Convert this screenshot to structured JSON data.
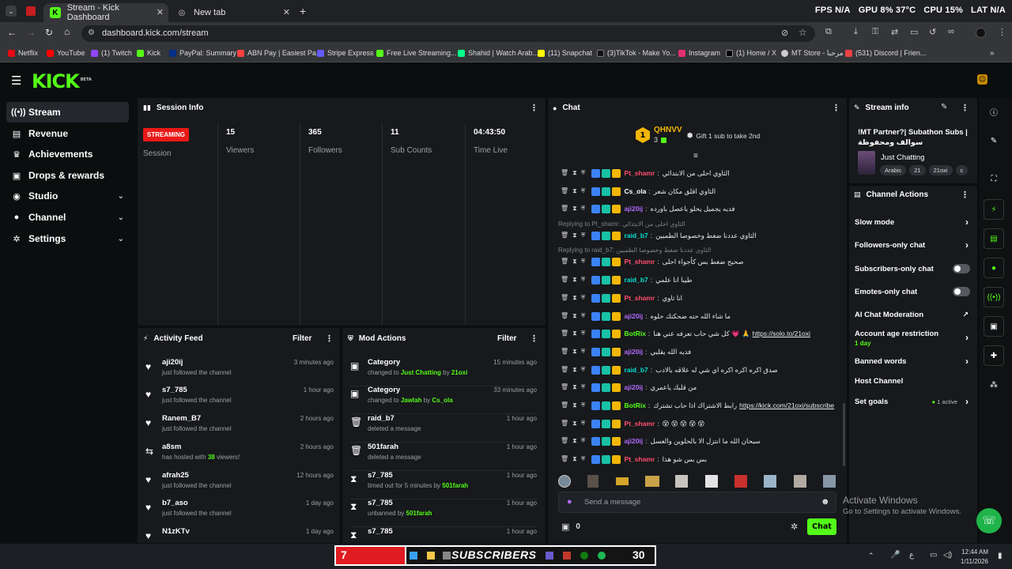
{
  "browser": {
    "tabs": [
      {
        "label": "Stream - Kick Dashboard"
      },
      {
        "label": "New tab"
      }
    ],
    "stats": {
      "fps": "FPS N/A",
      "gpu": "GPU 8% 37°C",
      "cpu": "CPU 15%",
      "lat": "LAT N/A"
    },
    "url": "dashboard.kick.com/stream",
    "bookmarks": [
      "Netflix",
      "YouTube",
      "(1) Twitch",
      "Kick",
      "PayPal: Summary",
      "ABN Pay | Easiest Pa...",
      "Stripe Express",
      "Free Live Streaming...",
      "Shahid | Watch Arab...",
      "(11) Snapchat",
      "(3)TikTok - Make Yo...",
      "Instagram",
      "(1) Home / X",
      "MT Store - مرحبا",
      "(531) Discord | Frien..."
    ]
  },
  "brand": {
    "logo": "KICK",
    "beta": "BETA",
    "accent": "#53fc18"
  },
  "sidebar": {
    "items": [
      {
        "label": "Stream",
        "icon": "stream-icon"
      },
      {
        "label": "Revenue",
        "icon": "revenue-icon"
      },
      {
        "label": "Achievements",
        "icon": "trophy-icon"
      },
      {
        "label": "Drops & rewards",
        "icon": "gift-icon"
      },
      {
        "label": "Studio",
        "icon": "studio-icon"
      },
      {
        "label": "Channel",
        "icon": "user-icon"
      },
      {
        "label": "Settings",
        "icon": "gear-icon"
      }
    ]
  },
  "session": {
    "title": "Session Info",
    "status": "STREAMING",
    "status_label": "Session",
    "stats": [
      {
        "value": "15",
        "label": "Viewers"
      },
      {
        "value": "365",
        "label": "Followers"
      },
      {
        "value": "11",
        "label": "Sub Counts"
      },
      {
        "value": "04:43:50",
        "label": "Time Live"
      }
    ]
  },
  "activity": {
    "title": "Activity Feed",
    "filter": "Filter",
    "items": [
      {
        "name": "aji20ij",
        "desc": "just followed the channel",
        "time": "3 minutes ago",
        "icon": "heart-icon"
      },
      {
        "name": "s7_785",
        "desc": "just followed the channel",
        "time": "1 hour ago",
        "icon": "heart-icon"
      },
      {
        "name": "Ranem_B7",
        "desc": "just followed the channel",
        "time": "2 hours ago",
        "icon": "heart-icon"
      },
      {
        "name": "a8sm",
        "desc_pre": "has hosted with ",
        "desc_hl": "38",
        "desc_post": " viewers!",
        "time": "2 hours ago",
        "icon": "host-icon"
      },
      {
        "name": "afrah25",
        "desc": "just followed the channel",
        "time": "12 hours ago",
        "icon": "heart-icon"
      },
      {
        "name": "b7_aso",
        "desc": "just followed the channel",
        "time": "1 day ago",
        "icon": "heart-icon"
      },
      {
        "name": "N1zKTv",
        "desc": "",
        "time": "1 day ago",
        "icon": "heart-icon"
      }
    ]
  },
  "mod": {
    "title": "Mod Actions",
    "filter": "Filter",
    "items": [
      {
        "name": "Category",
        "pre": "changed to ",
        "hl": "Just Chatting",
        "mid": " by ",
        "hl2": "21oxi",
        "time": "15 minutes ago",
        "icon": "category-icon"
      },
      {
        "name": "Category",
        "pre": "changed to ",
        "hl": "Jawlah",
        "mid": " by ",
        "hl2": "Cs_ola",
        "time": "33 minutes ago",
        "icon": "category-icon"
      },
      {
        "name": "raid_b7",
        "pre": "deleted a message",
        "hl": "",
        "mid": "",
        "hl2": "",
        "time": "1 hour ago",
        "icon": "trash-icon"
      },
      {
        "name": "501farah",
        "pre": "deleted a message",
        "hl": "",
        "mid": "",
        "hl2": "",
        "time": "1 hour ago",
        "icon": "trash-icon"
      },
      {
        "name": "s7_785",
        "pre": "timed out for 5 minutes by ",
        "hl": "501farah",
        "mid": "",
        "hl2": "",
        "time": "1 hour ago",
        "icon": "hourglass-icon"
      },
      {
        "name": "s7_785",
        "pre": "unbanned by ",
        "hl": "501farah",
        "mid": "",
        "hl2": "",
        "time": "1 hour ago",
        "icon": "hourglass-icon"
      },
      {
        "name": "s7_785",
        "pre": "",
        "hl": "",
        "mid": "",
        "hl2": "",
        "time": "1 hour ago",
        "icon": "hourglass-icon"
      }
    ]
  },
  "chat": {
    "title": "Chat",
    "gifter": {
      "name": "QHNVV",
      "rank": "1",
      "count": "3",
      "cta": "Gift 1 sub to take 2nd"
    },
    "messages": [
      {
        "user": "Pt_shamr",
        "color": "#ff4d6d",
        "text": "الثاوي احلى من الابتدائي"
      },
      {
        "user": "Cs_ola",
        "color": "#ffffff",
        "text": "الثاوي اقلق مكان شعر"
      },
      {
        "user": "aji20ij",
        "color": "#b36bff",
        "text": "فديه يجميل يحلو باعصل باورده"
      },
      {
        "reply": "Replying to Pt_shamr: الثاوي احلى من الابتدائي"
      },
      {
        "user": "raid_b7",
        "color": "#00e0d0",
        "text": "الثاوي عددنا ضغط وخصوصا الطمبين"
      },
      {
        "reply": "Replying to raid_b7: الثاوي عددنا ضغط وخصوصا الطمبين"
      },
      {
        "user": "Pt_shamr",
        "color": "#ff4d6d",
        "text": "صحيح ضغط بس كأجواء احلى"
      },
      {
        "user": "raid_b7",
        "color": "#00e0d0",
        "text": "طيبا انا علمي"
      },
      {
        "user": "Pt_shamr",
        "color": "#ff4d6d",
        "text": "انا ثاوي"
      },
      {
        "user": "aji20ij",
        "color": "#b36bff",
        "text": "ما شاء الله حته ضحكتك حلوه"
      },
      {
        "user": "BotRix",
        "color": "#53fc18",
        "text": "كل شي حاب تعرفه عني هنا 💗 🙏",
        "link": "https://solo.to/21oxi"
      },
      {
        "user": "aji20ij",
        "color": "#b36bff",
        "text": "فديه الله يقلبي"
      },
      {
        "user": "raid_b7",
        "color": "#00e0d0",
        "text": "صدق اكره اكره اكره اي شي له علاقه بالادب"
      },
      {
        "user": "aji20ij",
        "color": "#b36bff",
        "text": "من قلبك ياعمري"
      },
      {
        "user": "BotRix",
        "color": "#53fc18",
        "text": "رابط الاشتراك اذا حاب تشترك",
        "link": "https://kick.com/21oxi/subscribe"
      },
      {
        "user": "Pt_shamr",
        "color": "#ff4d6d",
        "text": "😵 😵 😵 😵 😵"
      },
      {
        "user": "aji20ij",
        "color": "#b36bff",
        "text": "سبحان الله ما انتزل الا بالحلوين والعسل"
      },
      {
        "user": "Pt_shamr",
        "color": "#ff4d6d",
        "text": "بس بس شو هذا"
      }
    ],
    "input_placeholder": "Send a message",
    "points": "0",
    "send_label": "Chat"
  },
  "stream_info": {
    "title": "Stream info",
    "stream_title": "!MT Partner?| Subathon Subs | سوالف ومحفوظة",
    "category": "Just Chatting",
    "tags": [
      "Arabic",
      "21",
      "21oxi",
      "c"
    ]
  },
  "channel_actions": {
    "title": "Channel Actions",
    "items": [
      {
        "label": "Slow mode",
        "kind": "arrow"
      },
      {
        "label": "Followers-only chat",
        "kind": "arrow"
      },
      {
        "label": "Subscribers-only chat",
        "kind": "toggle"
      },
      {
        "label": "Emotes-only chat",
        "kind": "toggle"
      },
      {
        "label": "AI Chat Moderation",
        "kind": "external"
      },
      {
        "label": "Account age restriction",
        "sub": "1 day",
        "kind": "arrow"
      },
      {
        "label": "Banned words",
        "kind": "arrow"
      },
      {
        "label": "Host Channel",
        "kind": "none"
      },
      {
        "label": "Set goals",
        "sub": "1 active",
        "kind": "arrow"
      }
    ]
  },
  "watermark": {
    "title": "Activate Windows",
    "sub": "Go to Settings to activate Windows."
  },
  "taskbar": {
    "counter_left": "7",
    "banner": "SUBSCRIBERS",
    "counter_right": "30",
    "time": "12:44 AM",
    "date": "1/11/2026"
  }
}
